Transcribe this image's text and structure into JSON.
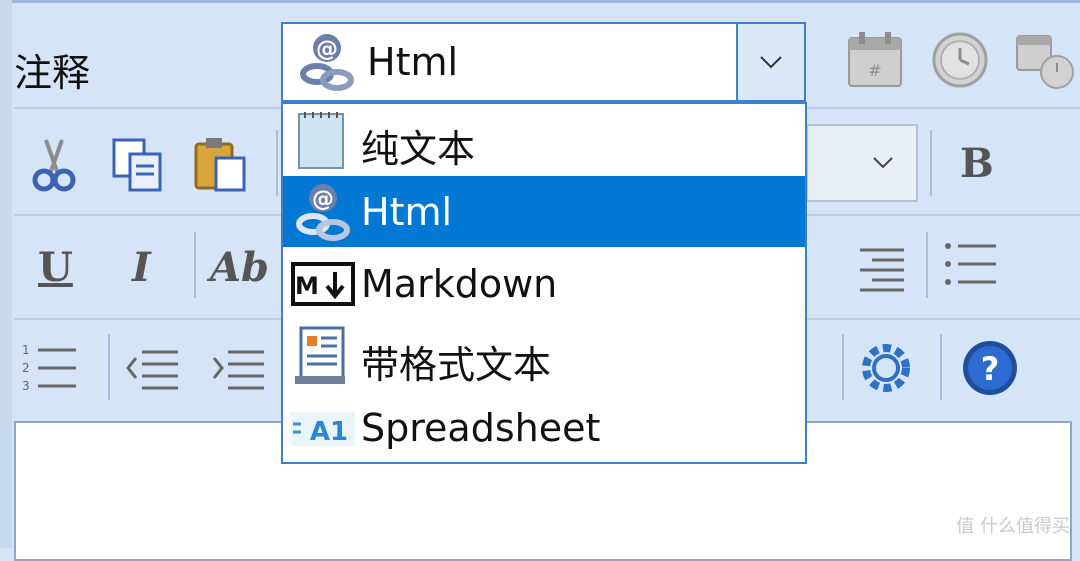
{
  "note_label": "注释",
  "format_select": {
    "selected_value": "Html",
    "options": [
      {
        "label": "纯文本",
        "icon": "notepad-icon"
      },
      {
        "label": "Html",
        "icon": "html-at-link-icon"
      },
      {
        "label": "Markdown",
        "icon": "markdown-icon"
      },
      {
        "label": "带格式文本",
        "icon": "rich-text-document-icon"
      },
      {
        "label": "Spreadsheet",
        "icon": "spreadsheet-a1-icon"
      }
    ],
    "highlighted_option": "Html"
  },
  "toolbar": {
    "bold_label": "B",
    "underline_label": "U",
    "italic_label": "I",
    "font_style_label": "Ab"
  },
  "watermark": "值 什么值得买",
  "colors": {
    "accent": "#0078d4",
    "panel": "#d6e4f7",
    "border": "#3f7fc9"
  }
}
